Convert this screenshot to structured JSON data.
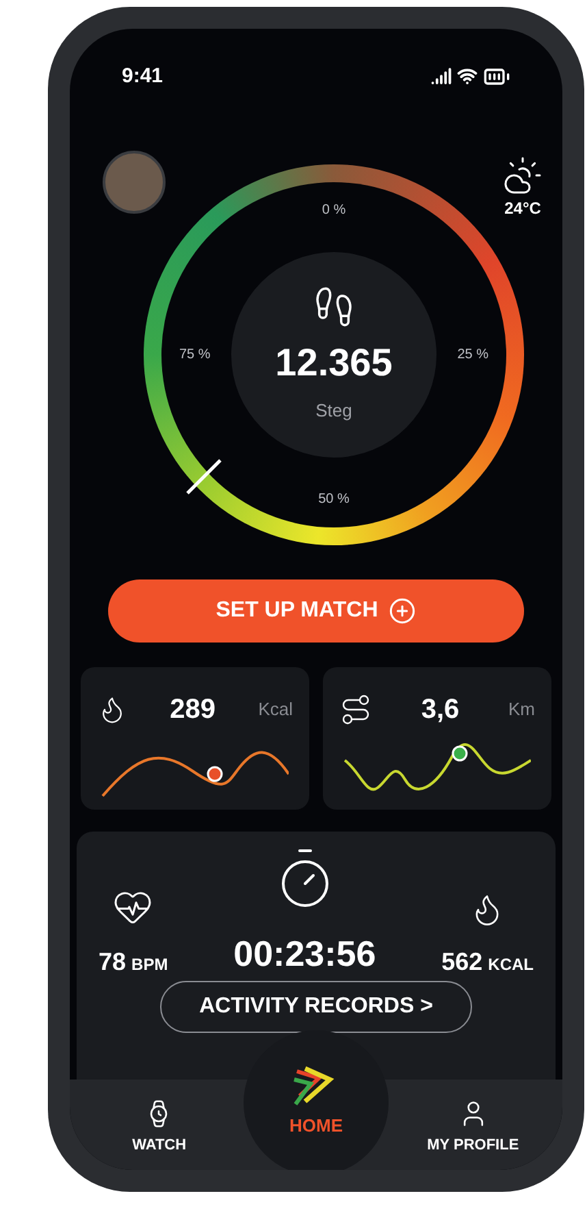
{
  "status_bar": {
    "time": "9:41"
  },
  "weather": {
    "temperature": "24°C"
  },
  "gauge": {
    "value": "12.365",
    "unit": "Steg",
    "ticks": [
      "0 %",
      "25 %",
      "50 %",
      "75 %"
    ]
  },
  "match_button": {
    "label": "SET UP MATCH"
  },
  "stat_cards": [
    {
      "kind": "calories",
      "value": "289",
      "unit": "Kcal"
    },
    {
      "kind": "distance",
      "value": "3,6",
      "unit": "Km"
    }
  ],
  "activity": {
    "metrics": [
      {
        "kind": "heart",
        "value": "78",
        "unit": "BPM"
      },
      {
        "kind": "timer",
        "value": "00:23:56"
      },
      {
        "kind": "calories",
        "value": "562",
        "unit": "KCAL"
      }
    ],
    "records_button": {
      "label": "ACTIVITY RECORDS >"
    }
  },
  "nav": [
    {
      "kind": "watch",
      "label": "WATCH",
      "selected": false
    },
    {
      "kind": "home",
      "label": "HOME",
      "selected": true
    },
    {
      "kind": "profile",
      "label": "MY PROFILE",
      "selected": false
    }
  ]
}
